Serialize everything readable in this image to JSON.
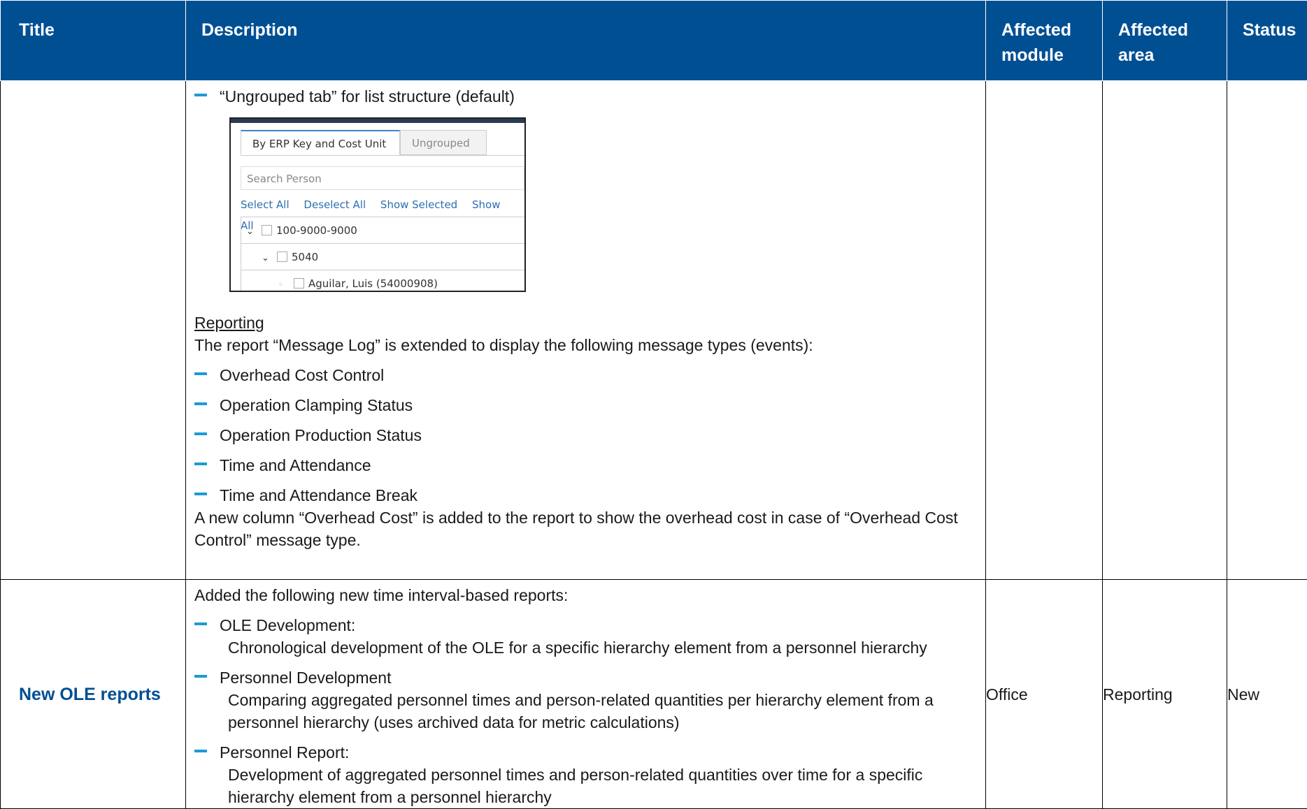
{
  "header": {
    "title": "Title",
    "description": "Description",
    "affected_module": "Affected module",
    "affected_area": "Affected area",
    "status": "Status"
  },
  "row1": {
    "intro_bullet": "“Ungrouped tab” for list structure (default)",
    "screenshot": {
      "tab_active": "By ERP Key and Cost Unit",
      "tab_inactive": "Ungrouped",
      "search_placeholder": "Search Person",
      "links": [
        "Select All",
        "Deselect All",
        "Show Selected",
        "Show All"
      ],
      "tree": [
        "100-9000-9000",
        "5040",
        "Aguilar, Luis (54000908)"
      ]
    },
    "section_title": "Reporting",
    "paragraph": "The report “Message Log” is extended to display the following message types (events):",
    "bullets": [
      "Overhead Cost Control",
      "Operation Clamping Status",
      "Operation Production Status",
      "Time and Attendance",
      "Time and Attendance Break"
    ],
    "closing": "A new column “Overhead Cost” is added to the report to show the overhead cost in case of “Overhead Cost Control” message type."
  },
  "row2": {
    "title": "New OLE reports",
    "intro": "Added the following new time interval-based reports:",
    "items": [
      {
        "name": "OLE Development:",
        "text": "Chronological development of the OLE for a specific hierarchy element from a personnel hierarchy"
      },
      {
        "name": "Personnel Development",
        "text": "Comparing aggregated personnel times and person-related quantities per hierarchy element from a personnel hierarchy (uses archived data for metric calculations)"
      },
      {
        "name": "Personnel Report:",
        "text": "Development of aggregated personnel times and person-related quantities over time for a specific hierarchy element from a personnel hierarchy"
      }
    ],
    "module": "Office",
    "area": "Reporting",
    "status": "New"
  },
  "colors": {
    "header_bg": "#004f93",
    "accent_dash": "#1d9ad6",
    "title_text": "#004f93"
  }
}
